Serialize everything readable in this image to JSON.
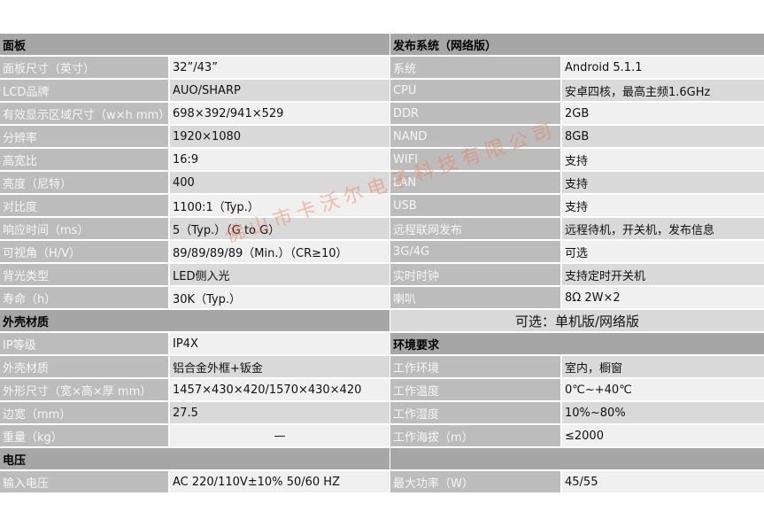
{
  "left": [
    {
      "type": "section",
      "label": "面板"
    },
    {
      "type": "row",
      "label": "面板尺寸（英寸）",
      "value": "32”/43”"
    },
    {
      "type": "row",
      "label": "LCD品牌",
      "value": "AUO/SHARP"
    },
    {
      "type": "row",
      "label": "有效显示区域尺寸（w×h mm）",
      "value": "698×392/941×529"
    },
    {
      "type": "row",
      "label": "分辨率",
      "value": "1920×1080"
    },
    {
      "type": "row",
      "label": "高宽比",
      "value": "16:9"
    },
    {
      "type": "row",
      "label": "亮度（尼特）",
      "value": "400"
    },
    {
      "type": "row",
      "label": "对比度",
      "value": "1100:1（Typ.）"
    },
    {
      "type": "row",
      "label": "响应时间（ms）",
      "value": "5（Typ.）（G to G）"
    },
    {
      "type": "row",
      "label": "可视角（H/V）",
      "value": "89/89/89/89（Min.）（CR≥10）"
    },
    {
      "type": "row",
      "label": "背光类型",
      "value": "LED侧入光"
    },
    {
      "type": "row",
      "label": "寿命（h）",
      "value": "30K（Typ.）"
    },
    {
      "type": "section",
      "label": "外壳材质"
    },
    {
      "type": "row",
      "label": "IP等级",
      "value": "IP4X"
    },
    {
      "type": "row",
      "label": "外壳材质",
      "value": "铝合金外框+钣金"
    },
    {
      "type": "row",
      "label": "外形尺寸（宽×高×厚 mm）",
      "value": "1457×430×420/1570×430×420"
    },
    {
      "type": "row",
      "label": "边宽（mm）",
      "value": "27.5"
    },
    {
      "type": "row",
      "label": "重量（kg）",
      "value": "—",
      "center": true
    },
    {
      "type": "section",
      "label": "电压"
    },
    {
      "type": "row",
      "label": "输入电压",
      "value": "AC 220/110V±10%  50/60 HZ"
    }
  ],
  "right": [
    {
      "type": "section",
      "label": "发布系统（网络版）"
    },
    {
      "type": "row",
      "label": "系统",
      "value": "Android 5.1.1"
    },
    {
      "type": "row",
      "label": "CPU",
      "value": "安卓四核，最高主频1.6GHz"
    },
    {
      "type": "row",
      "label": "DDR",
      "value": "2GB"
    },
    {
      "type": "row",
      "label": "NAND",
      "value": "8GB"
    },
    {
      "type": "row",
      "label": "WIFI",
      "value": "支持"
    },
    {
      "type": "row",
      "label": "LAN",
      "value": "支持"
    },
    {
      "type": "row",
      "label": "USB",
      "value": "支持"
    },
    {
      "type": "row",
      "label": "远程联网发布",
      "value": "远程待机，开关机，发布信息"
    },
    {
      "type": "row",
      "label": "3G/4G",
      "value": "可选"
    },
    {
      "type": "row",
      "label": "实时时钟",
      "value": "支持定时开关机"
    },
    {
      "type": "row",
      "label": "喇叭",
      "value": "8Ω 2W×2"
    },
    {
      "type": "full",
      "label": "可选：单机版/网络版"
    },
    {
      "type": "section",
      "label": "环境要求"
    },
    {
      "type": "row",
      "label": "工作环境",
      "value": "室内，橱窗"
    },
    {
      "type": "row",
      "label": "工作温度",
      "value": "0℃~+40℃"
    },
    {
      "type": "row",
      "label": "工作湿度",
      "value": "10%~80%"
    },
    {
      "type": "row",
      "label": "工作海拔（m）",
      "value": "≤2000"
    },
    {
      "type": "blank"
    },
    {
      "type": "row",
      "label": "最大功率（W）",
      "value": "45/55"
    }
  ],
  "watermark": "佛山市卡沃尔电子科技有限公司"
}
